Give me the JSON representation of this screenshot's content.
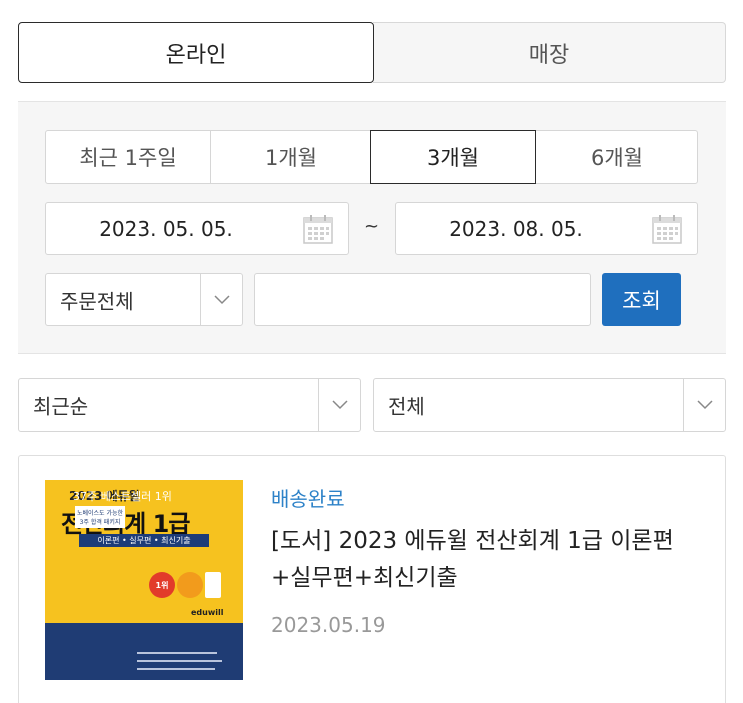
{
  "tabs": {
    "online": "온라인",
    "store": "매장"
  },
  "period": {
    "options": [
      "최근 1주일",
      "1개월",
      "3개월",
      "6개월"
    ],
    "selected": "3개월"
  },
  "dates": {
    "start": "2023. 05. 05.",
    "end": "2023. 08. 05.",
    "separator": "~"
  },
  "order_type": {
    "selected": "주문전체"
  },
  "search": {
    "value": "",
    "placeholder": "",
    "button_label": "조회"
  },
  "sort": {
    "selected": "최근순"
  },
  "category": {
    "selected": "전체"
  },
  "order": {
    "status": "배송완료",
    "title": "[도서] 2023 에듀윌 전산회계 1급 이론편+실무편+최신기출",
    "date": "2023.05.19",
    "cover": {
      "year_brand": "2023 에듀윌",
      "title": "전산회계 1급",
      "subtitle": "이론편 • 실무편 • 최신기출",
      "badge": "1위",
      "brand": "eduwill",
      "bottom_text": "37주 베스트셀러 1위",
      "bottom_box": "노베이스도 가능한 3주 합격 패키지"
    }
  },
  "colors": {
    "accent_blue": "#1f6fbe",
    "status_blue": "#2d82c8",
    "cover_yellow": "#f6c21f",
    "cover_navy": "#1f3c74"
  }
}
